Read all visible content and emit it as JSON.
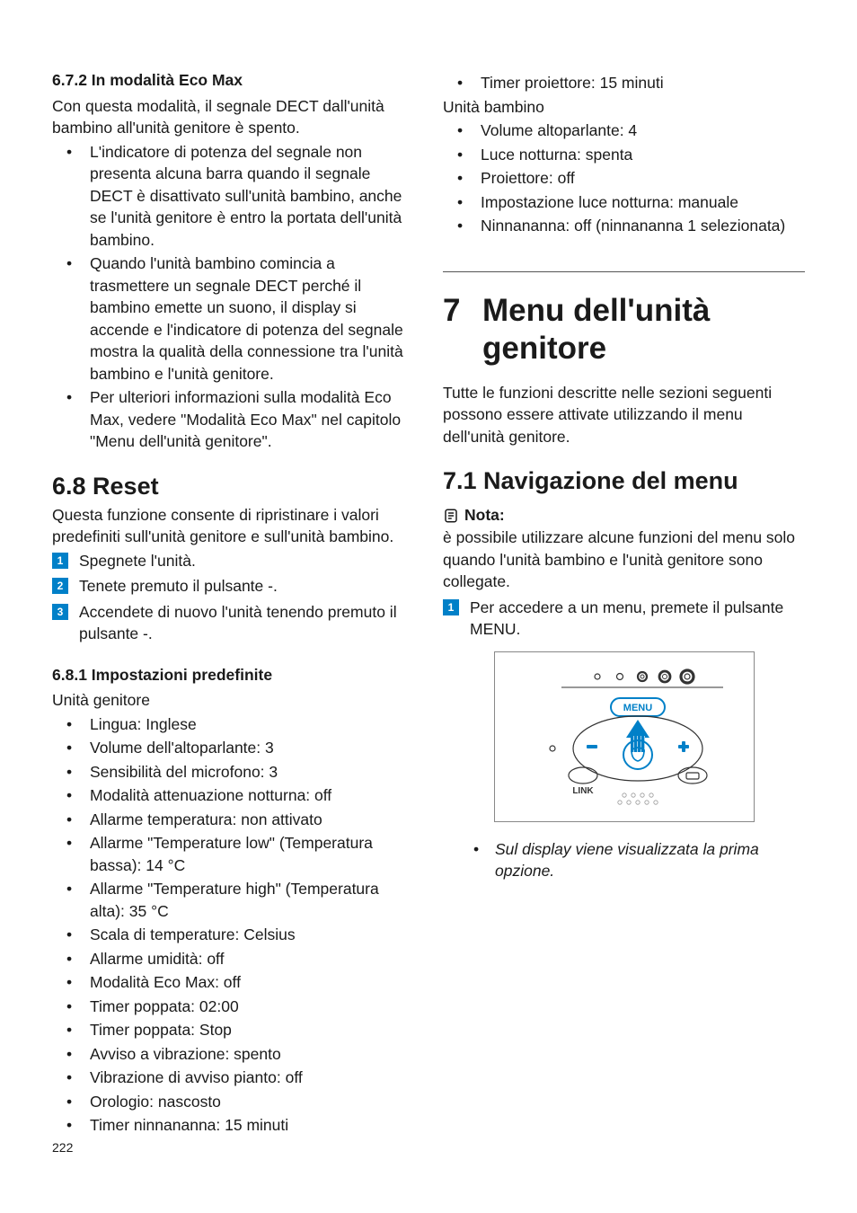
{
  "left": {
    "s672": {
      "heading": "6.7.2 In modalità Eco Max",
      "intro": "Con questa modalità, il segnale DECT dall'unità bambino all'unità genitore è spento.",
      "bullets": [
        "L'indicatore di potenza del segnale non presenta alcuna barra quando il segnale DECT è disattivato sull'unità bambino, anche se l'unità genitore è entro la portata dell'unità bambino.",
        "Quando l'unità bambino comincia a trasmettere un segnale DECT perché il bambino emette un suono, il display si accende e l'indicatore di potenza del segnale mostra la qualità della connessione tra l'unità bambino e l'unità genitore.",
        "Per ulteriori informazioni sulla modalità Eco Max, vedere \"Modalità Eco Max\" nel capitolo \"Menu dell'unità genitore\"."
      ]
    },
    "s68": {
      "heading": "6.8 Reset",
      "intro": "Questa funzione consente di ripristinare i valori predefiniti sull'unità genitore e sull'unità bambino.",
      "steps": [
        "Spegnete l'unità.",
        "Tenete premuto il pulsante -.",
        "Accendete di nuovo l'unità tenendo premuto il pulsante -."
      ]
    },
    "s681": {
      "heading": "6.8.1 Impostazioni predefinite",
      "unit1_label": "Unità genitore",
      "unit1_items": [
        "Lingua: Inglese",
        "Volume dell'altoparlante: 3",
        "Sensibilità del microfono: 3",
        "Modalità attenuazione notturna: off",
        "Allarme temperatura: non attivato",
        "Allarme \"Temperature low\" (Temperatura bassa): 14 °C",
        "Allarme \"Temperature high\" (Temperatura alta): 35 °C",
        "Scala di temperature: Celsius",
        "Allarme umidità: off",
        "Modalità Eco Max: off",
        "Timer poppata: 02:00",
        "Timer poppata: Stop",
        "Avviso a vibrazione: spento",
        "Vibrazione di avviso pianto: off",
        "Orologio: nascosto",
        "Timer ninnananna: 15 minuti"
      ]
    }
  },
  "right": {
    "cont_bullets": [
      "Timer proiettore: 15 minuti"
    ],
    "unit2_label": "Unità bambino",
    "unit2_items": [
      "Volume altoparlante: 4",
      "Luce notturna: spenta",
      "Proiettore: off",
      "Impostazione luce notturna: manuale",
      "Ninnananna: off (ninnananna 1 selezionata)"
    ],
    "s7": {
      "num": "7",
      "title": "Menu dell'unità genitore",
      "intro": "Tutte le funzioni descritte nelle sezioni seguenti possono essere attivate utilizzando il menu dell'unità genitore."
    },
    "s71": {
      "heading": "7.1 Navigazione del menu",
      "note_label": "Nota:",
      "note_body": "è possibile utilizzare alcune funzioni del menu solo quando l'unità bambino e l'unità genitore sono collegate.",
      "step1": "Per accedere a un menu, premete il pulsante MENU.",
      "result": "Sul display viene visualizzata la prima opzione.",
      "illus": {
        "menu_label": "MENU",
        "link_label": "LINK"
      }
    }
  },
  "page_number": "222"
}
